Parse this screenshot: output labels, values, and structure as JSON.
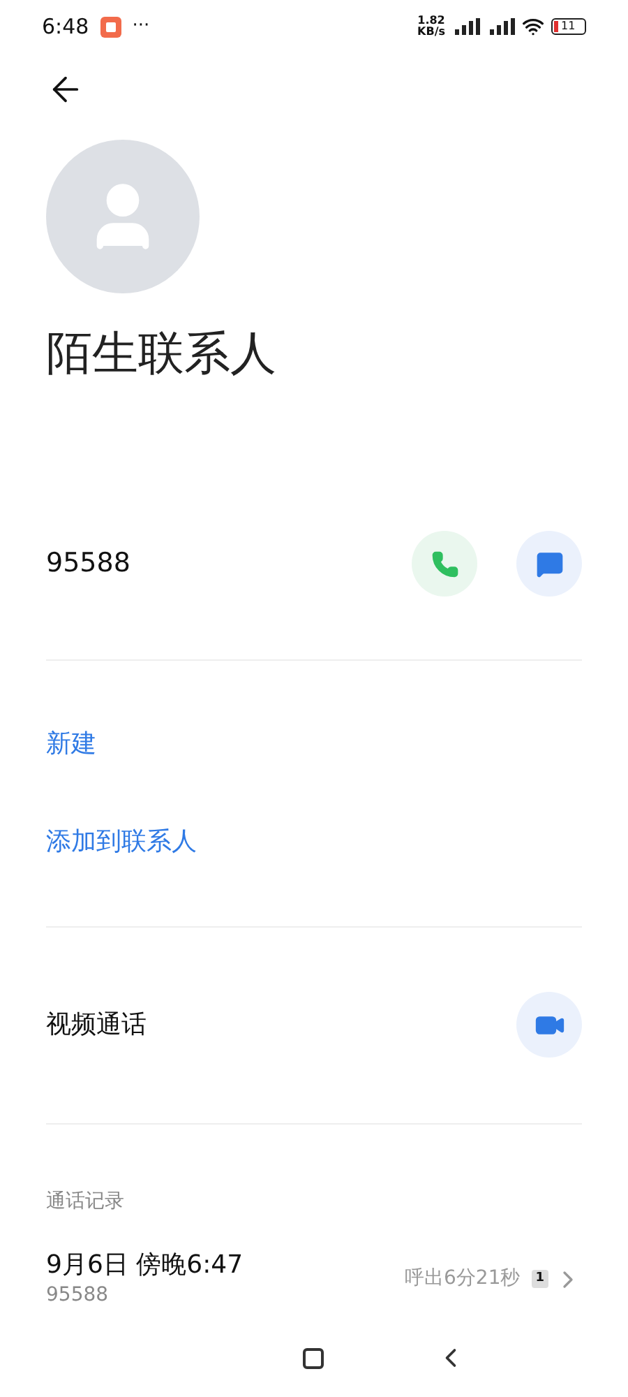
{
  "status_bar": {
    "time": "6:48",
    "more": "···",
    "speed": "1.82\nKB/s",
    "battery": "11"
  },
  "contact": {
    "name": "陌生联系人",
    "number": "95588"
  },
  "actions": [
    {
      "label": "新建"
    },
    {
      "label": "添加到联系人"
    }
  ],
  "video_call": {
    "label": "视频通话"
  },
  "call_log": {
    "heading": "通话记录",
    "entries": [
      {
        "date": "9月6日 傍晚6:47",
        "number": "95588",
        "detail": "呼出6分21秒",
        "sim": "1"
      }
    ]
  }
}
